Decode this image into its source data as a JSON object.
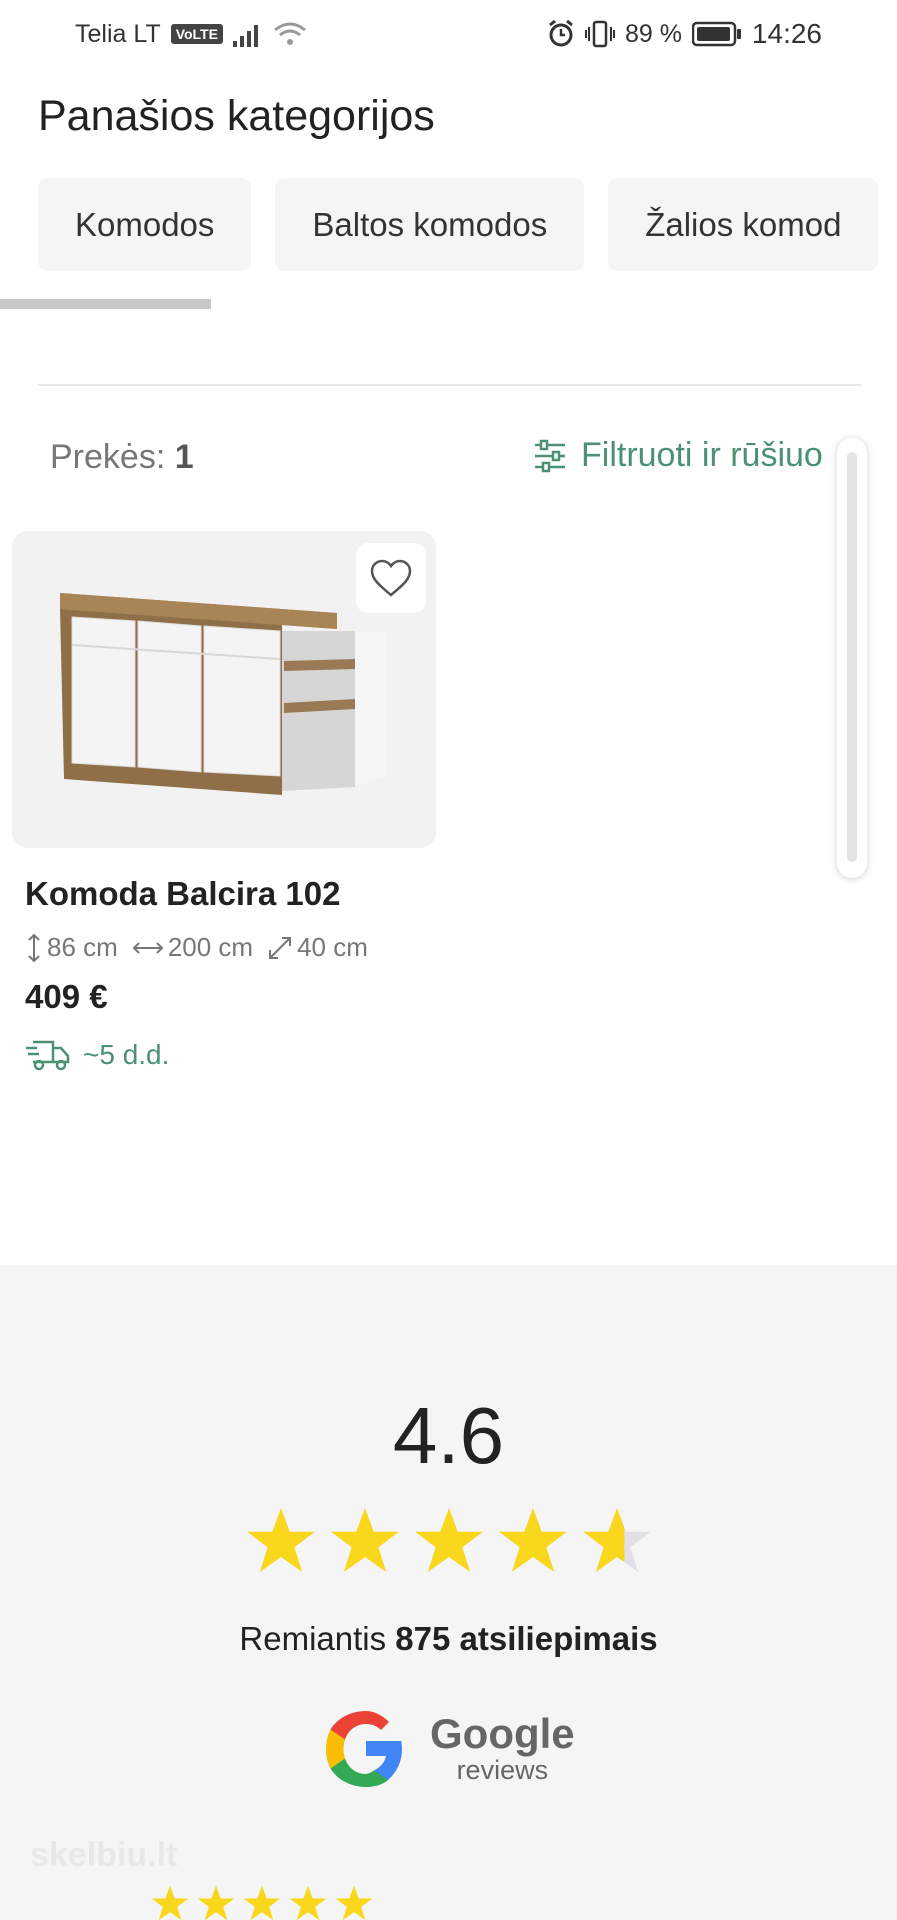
{
  "status_bar": {
    "carrier": "Telia LT",
    "volte": "VoLTE",
    "battery": "89 %",
    "time": "14:26"
  },
  "similar_categories": {
    "title": "Panašios kategorijos",
    "chips": [
      "Komodos",
      "Baltos komodos",
      "Žalios komod"
    ]
  },
  "listing": {
    "count_label": "Prekės:",
    "count_value": "1",
    "filter_label": "Filtruoti ir rūšiuo"
  },
  "product": {
    "name": "Komoda Balcira 102",
    "height": "86 cm",
    "width": "200 cm",
    "depth": "40 cm",
    "price": "409 €",
    "delivery": "~5 d.d."
  },
  "reviews": {
    "rating": "4.6",
    "stars_value": 4.6,
    "based_prefix": "Remiantis",
    "based_count": "875 atsiliepimais",
    "google_word": "Google",
    "google_sub": "reviews",
    "watermark": "skelbiu.lt"
  },
  "colors": {
    "accent_green": "#4b9272",
    "star_yellow": "#f9d71c",
    "star_empty": "#e0e0e6"
  }
}
